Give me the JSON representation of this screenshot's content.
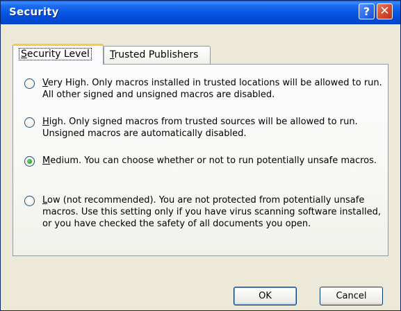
{
  "window": {
    "title": "Security"
  },
  "titlebar": {
    "help_label": "?",
    "close_label": "✕"
  },
  "tabs": [
    {
      "label": "Security Level",
      "mnemonic": "S",
      "rest": "ecurity Level",
      "active": true
    },
    {
      "label": "Trusted Publishers",
      "mnemonic": "T",
      "rest": "rusted Publishers",
      "active": false
    }
  ],
  "options": [
    {
      "mnemonic": "V",
      "rest": "ery High. Only macros installed in trusted locations will be allowed to run. All other signed and unsigned macros are disabled.",
      "checked": false
    },
    {
      "mnemonic": "H",
      "rest": "igh. Only signed macros from trusted sources will be allowed to run. Unsigned macros are automatically disabled.",
      "checked": false
    },
    {
      "mnemonic": "M",
      "rest": "edium. You can choose whether or not to run potentially unsafe macros.",
      "checked": true
    },
    {
      "mnemonic": "L",
      "rest": "ow (not recommended). You are not protected from potentially unsafe macros. Use this setting only if you have virus scanning software installed, or you have checked the safety of all documents you open.",
      "checked": false
    }
  ],
  "buttons": {
    "ok": "OK",
    "cancel": "Cancel"
  }
}
